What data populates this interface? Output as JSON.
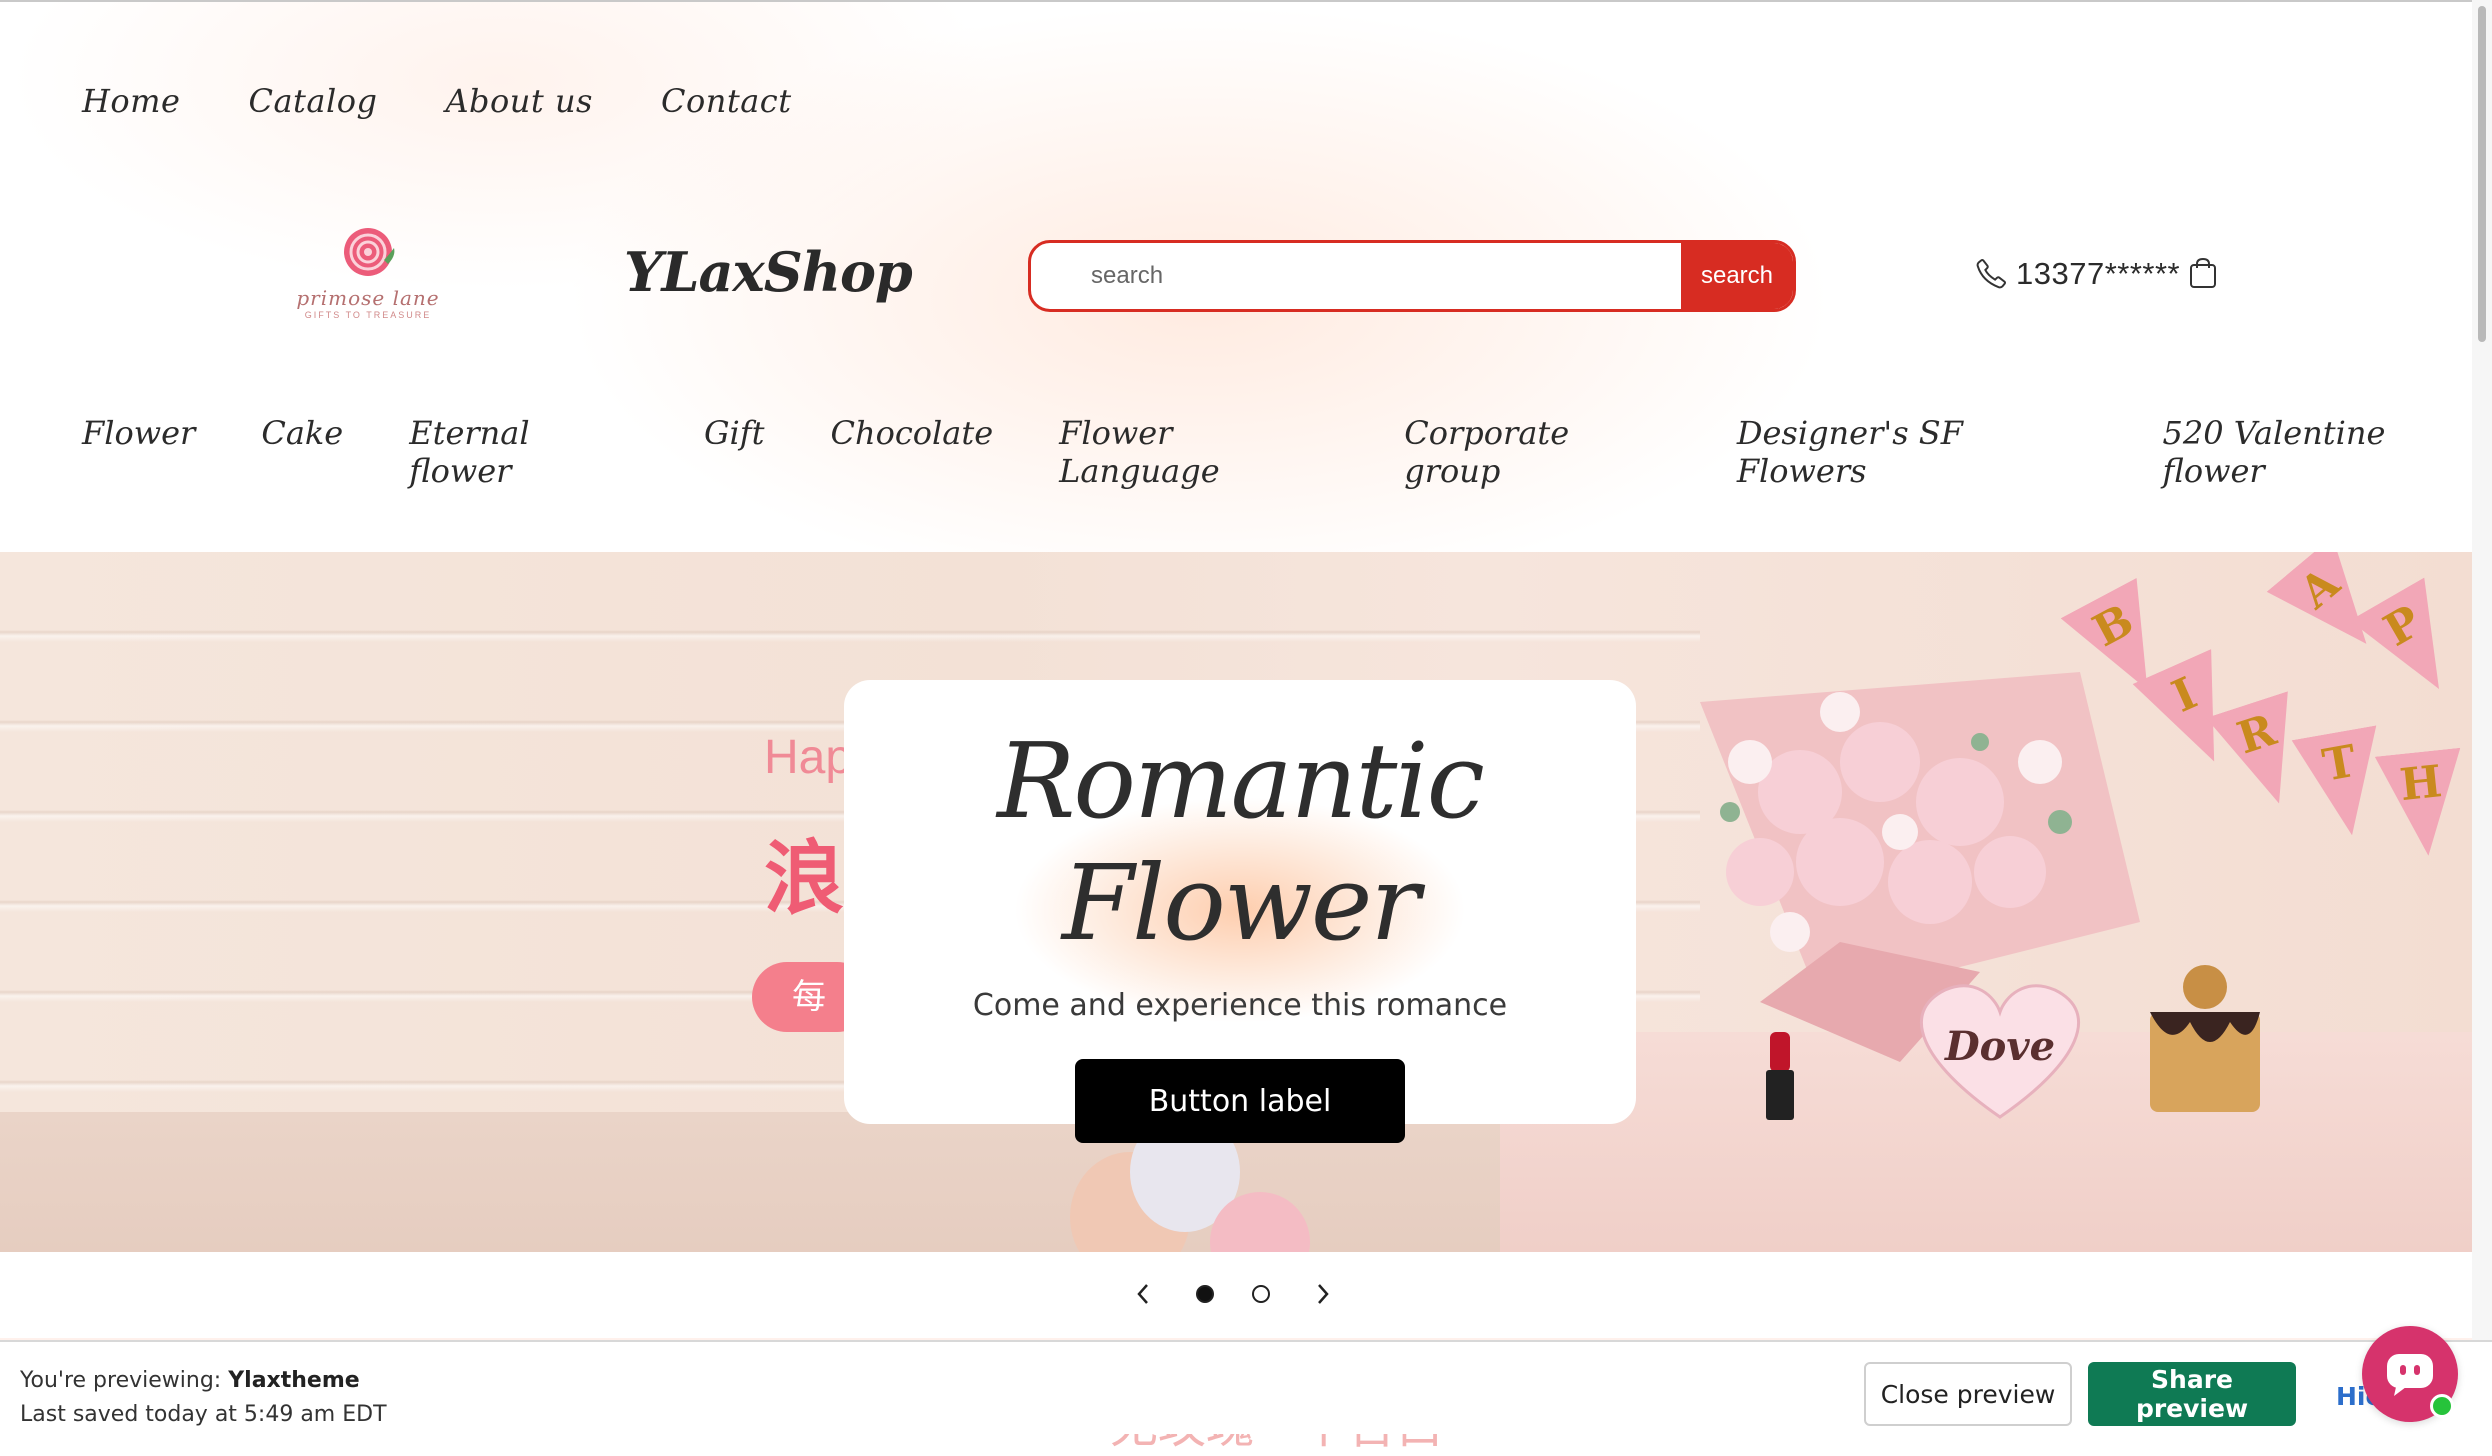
{
  "top_nav": [
    "Home",
    "Catalog",
    "About us",
    "Contact"
  ],
  "logo": {
    "name": "primose lane",
    "tagline": "GIFTS TO TREASURE"
  },
  "brand": "YLaxShop",
  "search": {
    "placeholder": "search",
    "button": "search"
  },
  "phone": "13377******",
  "category_nav": [
    "Flower",
    "Cake",
    "Eternal flower",
    "Gift",
    "Chocolate",
    "Flower Language",
    "Corporate group",
    "Designer's SF Flowers",
    "520 Valentine flower"
  ],
  "hero": {
    "title": "Romantic Flower",
    "subtitle": "Come and experience this romance",
    "button": "Button label",
    "background_text": {
      "latin": "Hap",
      "cn": "浪",
      "pill": "每"
    },
    "garland_letters": [
      "B",
      "I",
      "R",
      "T",
      "H",
      "H",
      "A",
      "P"
    ],
    "brand_on_box": "Dove"
  },
  "slider": {
    "slides": 2,
    "active": 1
  },
  "below_text": "无玫瑰 · 不告白",
  "preview_bar": {
    "previewing_label": "You're previewing:",
    "theme_name": "Ylaxtheme",
    "saved_text": "Last saved today at 5:49 am EDT",
    "close_button": "Close preview",
    "share_button": "Share preview",
    "hide_link": "Hic"
  },
  "colors": {
    "accent": "#d72c22",
    "share_green": "#0f7a54",
    "chat_pink": "#d6336c",
    "link_blue": "#2c6ecb"
  }
}
